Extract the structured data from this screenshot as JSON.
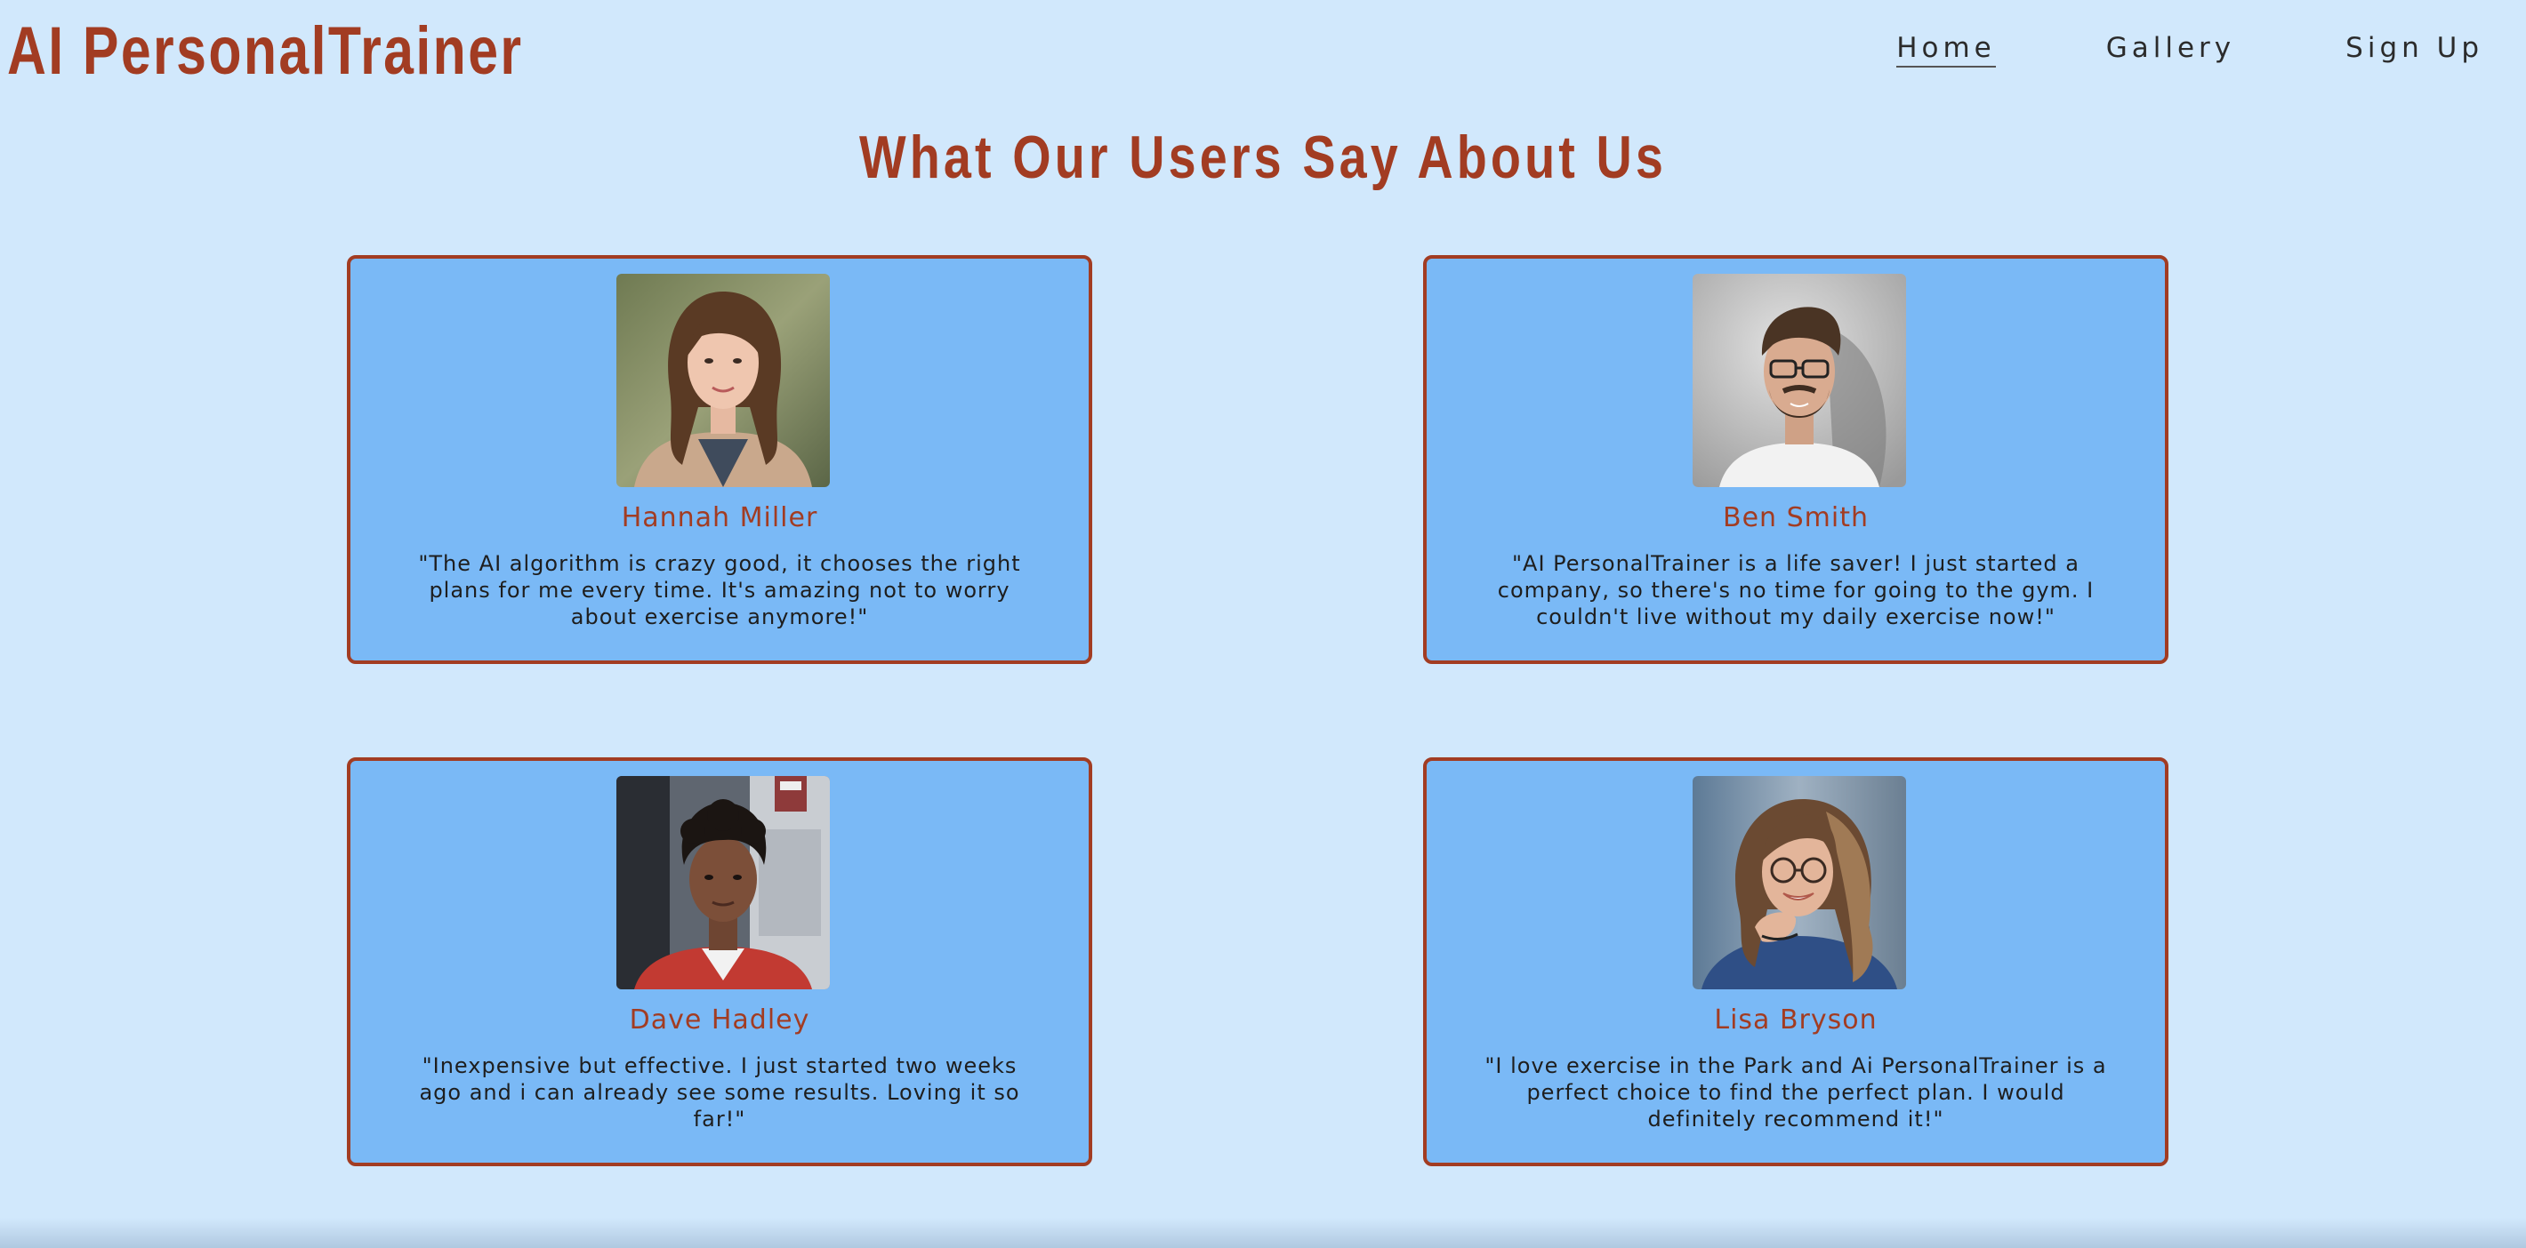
{
  "header": {
    "brand": "AI PersonalTrainer",
    "nav": [
      {
        "label": "Home",
        "active": true
      },
      {
        "label": "Gallery",
        "active": false
      },
      {
        "label": "Sign Up",
        "active": false
      }
    ]
  },
  "main": {
    "title": "What Our Users Say About Us",
    "testimonials": [
      {
        "name": "Hannah Miller",
        "quote": "\"The AI algorithm is crazy good, it chooses the right plans for me every time. It's amazing not to worry about exercise anymore!\""
      },
      {
        "name": "Ben Smith",
        "quote": "\"AI PersonalTrainer is a life saver! I just started a company, so there's no time for going to the gym. I couldn't live without my daily exercise now!\""
      },
      {
        "name": "Dave Hadley",
        "quote": "\"Inexpensive but effective. I just started two weeks ago and i can already see some results. Loving it so far!\""
      },
      {
        "name": "Lisa Bryson",
        "quote": "\"I love exercise in the Park and Ai PersonalTrainer is a perfect choice to find the perfect plan. I would definitely recommend it!\""
      }
    ]
  },
  "theme": {
    "background": "#d1e8fc",
    "card_background": "#7ab9f6",
    "accent": "#a23c22",
    "text": "#1e1e1e"
  }
}
